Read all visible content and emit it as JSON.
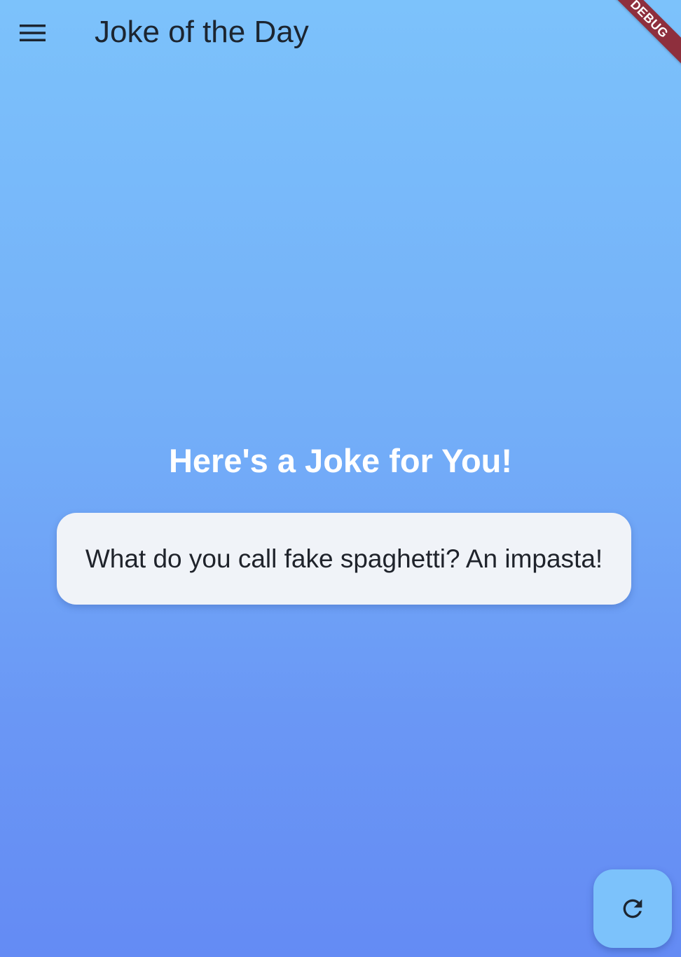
{
  "app_bar": {
    "title": "Joke of the Day",
    "menu_icon": "hamburger-menu-icon"
  },
  "debug_banner": {
    "label": "DEBUG",
    "color": "#8e2f3d"
  },
  "main": {
    "heading": "Here's a Joke for You!",
    "joke": "What do you call fake spaghetti? An impasta!"
  },
  "fab": {
    "icon": "refresh-icon"
  },
  "colors": {
    "gradient_top": "#7cc2fb",
    "gradient_bottom": "#648bf4",
    "card_background": "#f0f3f8",
    "fab_background": "#7cc2fb"
  }
}
